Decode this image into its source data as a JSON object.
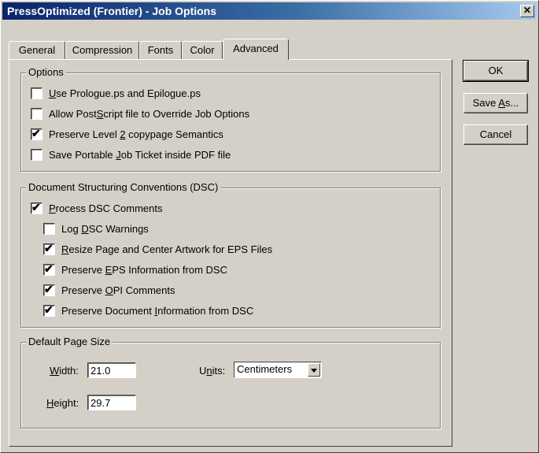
{
  "window": {
    "title": "PressOptimized (Frontier)  - Job Options",
    "close_glyph": "✕"
  },
  "tabs": [
    {
      "label": "General"
    },
    {
      "label": "Compression"
    },
    {
      "label": "Fonts"
    },
    {
      "label": "Color"
    },
    {
      "label": "Advanced",
      "active": true
    }
  ],
  "buttons": {
    "ok": "OK",
    "save_as_pre": "Save ",
    "save_as_u": "A",
    "save_as_post": "s...",
    "cancel": "Cancel"
  },
  "options": {
    "legend": "Options",
    "items": [
      {
        "pre": "",
        "u": "U",
        "post": "se Prologue.ps and Epilogue.ps",
        "checked": false
      },
      {
        "pre": "Allow Post",
        "u": "S",
        "post": "cript file to Override Job Options",
        "checked": false
      },
      {
        "pre": "Preserve Level ",
        "u": "2",
        "post": " copypage Semantics",
        "checked": true
      },
      {
        "pre": "Save Portable ",
        "u": "J",
        "post": "ob Ticket inside PDF file",
        "checked": false
      }
    ]
  },
  "dsc": {
    "legend": "Document Structuring Conventions (DSC)",
    "process": {
      "pre": "",
      "u": "P",
      "post": "rocess DSC Comments",
      "checked": true
    },
    "items": [
      {
        "pre": "Log ",
        "u": "D",
        "post": "SC Warnings",
        "checked": false
      },
      {
        "pre": "",
        "u": "R",
        "post": "esize Page and Center Artwork for EPS Files",
        "checked": true
      },
      {
        "pre": "Preserve ",
        "u": "E",
        "post": "PS Information from DSC",
        "checked": true
      },
      {
        "pre": "Preserve ",
        "u": "O",
        "post": "PI Comments",
        "checked": true
      },
      {
        "pre": "Preserve Document ",
        "u": "I",
        "post": "nformation from DSC",
        "checked": true
      }
    ]
  },
  "page_size": {
    "legend": "Default Page Size",
    "width_u": "W",
    "width_rest": "idth:",
    "width_value": "21.0",
    "height_u": "H",
    "height_rest": "eight:",
    "height_value": "29.7",
    "units_pre": "U",
    "units_u": "n",
    "units_post": "its:",
    "units_value": "Centimeters"
  },
  "check_glyph": "✔"
}
